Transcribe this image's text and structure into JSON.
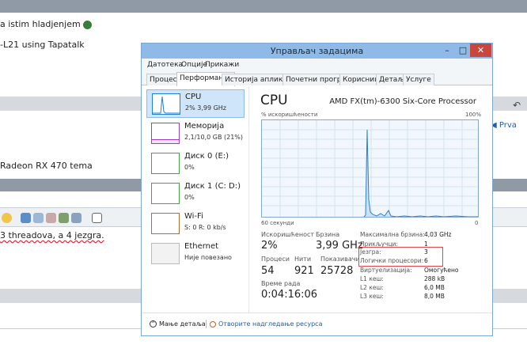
{
  "forum": {
    "line1": "a istim hladjenjem",
    "line2": "-L21 using Tapatalk",
    "line3": "Radeon RX 470 tema",
    "line4": "3 threadova, a 4 jezgra.",
    "prva_label": "◀ Prva"
  },
  "window": {
    "title": "Управљач задацима",
    "controls": {
      "minimize": "–",
      "maximize": "□",
      "close": "✕"
    }
  },
  "menu": [
    "Датотека",
    "Опције",
    "Прикажи"
  ],
  "tabs": [
    "Процеси",
    "Перформансе",
    "Историја апликација",
    "Почетни програми",
    "Корисници",
    "Детаљи",
    "Услуге"
  ],
  "active_tab": "Перформансе",
  "resources": [
    {
      "name": "CPU",
      "detail": "2% 3,99 GHz",
      "color": "#1f7fd0"
    },
    {
      "name": "Меморија",
      "detail": "2,1/10,0 GB (21%)",
      "color": "#9b3fc7"
    },
    {
      "name": "Диск 0 (E:)",
      "detail": "0%",
      "color": "#3da83a"
    },
    {
      "name": "Диск 1 (C: D:)",
      "detail": "0%",
      "color": "#3da83a"
    },
    {
      "name": "Wi-Fi",
      "detail": "S: 0 R: 0 kb/s",
      "color": "#b86a2a"
    },
    {
      "name": "Ethernet",
      "detail": "Није повезано",
      "color": "#888888"
    }
  ],
  "detail": {
    "heading": "CPU",
    "model": "AMD FX(tm)-6300 Six-Core Processor",
    "graph": {
      "top_left": "% искоришћености",
      "top_right": "100%",
      "bottom_left": "60 секунди",
      "bottom_right": "0"
    },
    "stats": {
      "usage_label": "Искоришћеност",
      "usage_value": "2%",
      "speed_label": "Брзина",
      "speed_value": "3,99 GHz",
      "processes_label": "Процеси",
      "processes_value": "54",
      "threads_label": "Нити",
      "threads_value": "921",
      "handles_label": "Показивачи",
      "handles_value": "25728",
      "uptime_label": "Време рада",
      "uptime_value": "0:04:16:06"
    },
    "props": [
      {
        "label": "Максимална брзина:",
        "value": "4,03 GHz"
      },
      {
        "label": "Прикључци:",
        "value": "1"
      },
      {
        "label": "Језгра:",
        "value": "3"
      },
      {
        "label": "Логички процесори:",
        "value": "6"
      },
      {
        "label": "Виртуелизација:",
        "value": "Омогућено"
      },
      {
        "label": "L1 кеш:",
        "value": "288 kB"
      },
      {
        "label": "L2 кеш:",
        "value": "6,0 MB"
      },
      {
        "label": "L3 кеш:",
        "value": "8,0 MB"
      }
    ]
  },
  "footer": {
    "less_details": "Мање детаља",
    "open_monitor": "Отворите надгледање ресурса"
  }
}
